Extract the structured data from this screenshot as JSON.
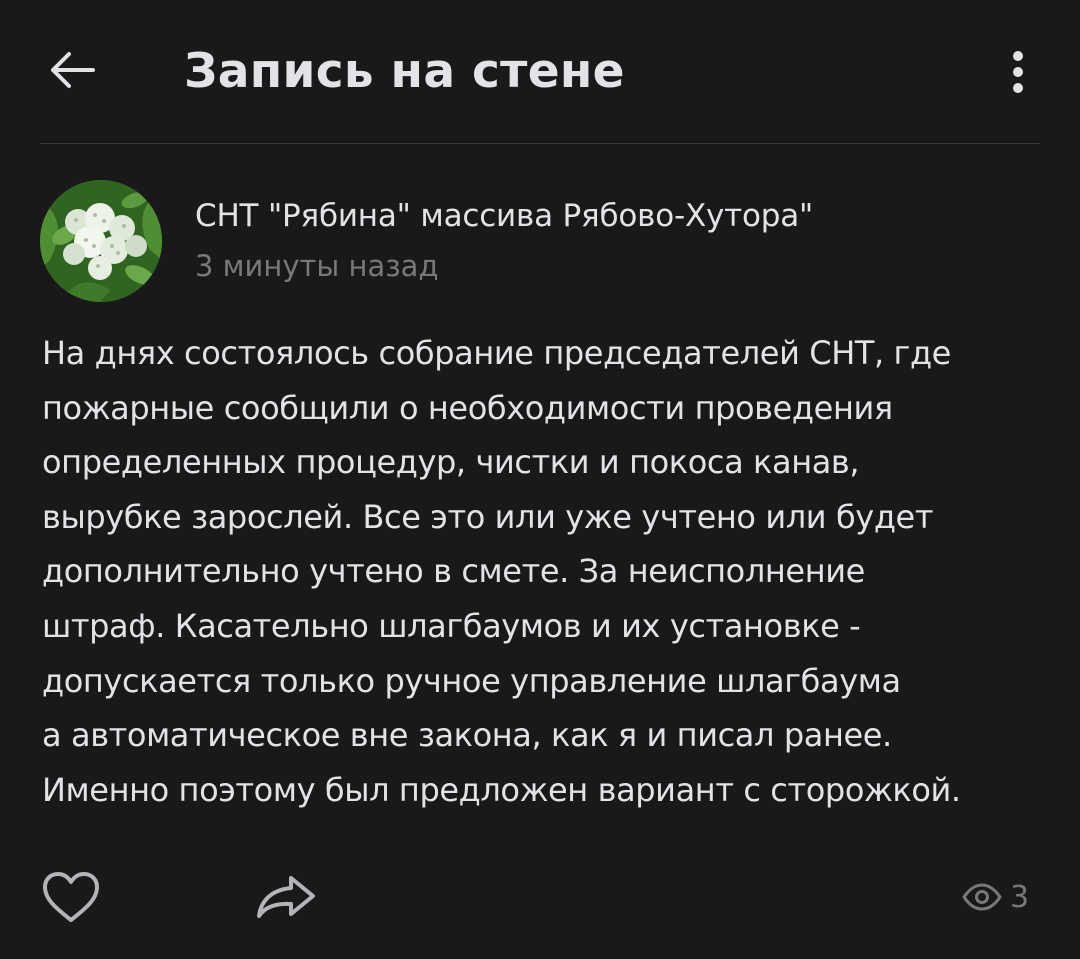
{
  "header": {
    "title": "Запись на стене",
    "back_icon": "arrow-left-icon",
    "more_icon": "more-vertical-icon"
  },
  "post": {
    "author": "СНТ \"Рябина\" массива Рябово-Хутора\"",
    "time": "3 минуты назад",
    "text_lines": [
      "На днях состоялось собрание председателей СНТ, где",
      "пожарные сообщили о необходимости проведения",
      "определенных процедур, чистки и покоса канав,",
      "вырубке зарослей. Все это или уже учтено или будет",
      "дополнительно учтено в смете. За неисполнение",
      "штраф. Касательно шлагбаумов и их установке -",
      "допускается только ручное управление шлагбаума",
      "а автоматическое вне закона, как я и писал ранее.",
      "Именно поэтому был предложен вариант с сторожкой."
    ]
  },
  "footer": {
    "like_icon": "heart-icon",
    "share_icon": "share-icon",
    "views_icon": "eye-icon",
    "views_count": "3"
  },
  "colors": {
    "background": "#19191a",
    "text_primary": "#e1e3e6",
    "text_secondary": "#76787a",
    "divider": "#363738"
  }
}
